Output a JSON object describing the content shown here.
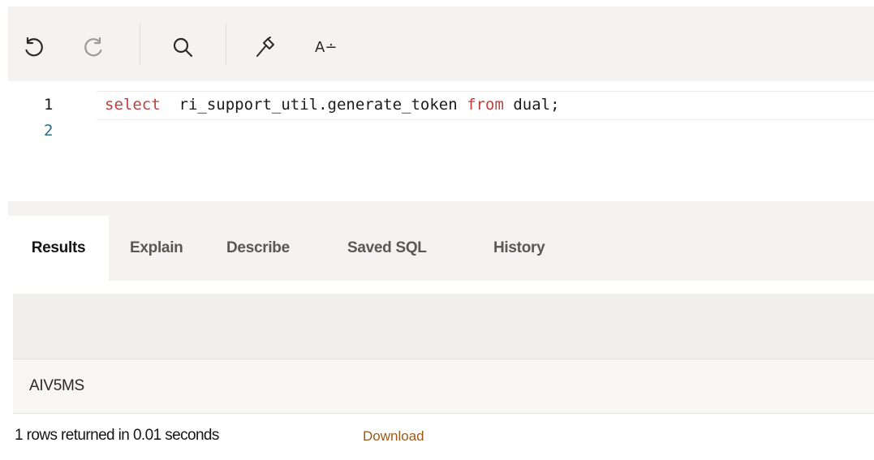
{
  "toolbar": {
    "buttons": [
      {
        "name": "undo-button",
        "icon": "undo-icon"
      },
      {
        "name": "redo-button",
        "icon": "redo-icon"
      },
      {
        "name": "find-button",
        "icon": "search-icon"
      },
      {
        "name": "query-builder-button",
        "icon": "hammer-icon"
      }
    ],
    "font_button_label": "A∸"
  },
  "editor": {
    "line_numbers": [
      "1",
      "2"
    ],
    "code": {
      "kw1": "select",
      "mid": "  ri_support_util.generate_token ",
      "kw2": "from",
      "tail": " dual;"
    }
  },
  "tabs": [
    {
      "label": "Results",
      "active": true
    },
    {
      "label": "Explain",
      "active": false
    },
    {
      "label": "Describe",
      "active": false
    },
    {
      "label": "Saved SQL",
      "active": false
    },
    {
      "label": "History",
      "active": false
    }
  ],
  "results": {
    "column_header": "",
    "rows": [
      [
        "AIV5MS"
      ]
    ],
    "status_text": "1 rows returned in 0.01 seconds",
    "download_label": "Download"
  },
  "colors": {
    "keyword": "#c13e3e",
    "line2_number": "#2a6f86",
    "download_link": "#9a5a1c",
    "toolbar_bg": "#f4f3f2"
  }
}
